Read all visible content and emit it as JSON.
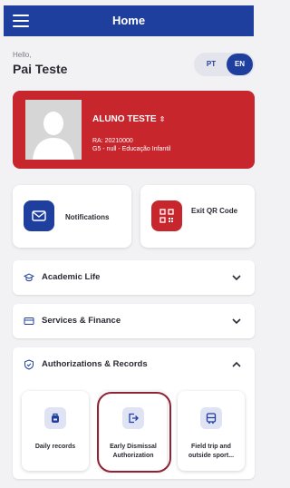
{
  "header": {
    "title": "Home"
  },
  "user": {
    "greeting": "Hello,",
    "name": "Pai Teste"
  },
  "language": {
    "pt": "PT",
    "en": "EN",
    "selected": "EN"
  },
  "student": {
    "name": "ALUNO TESTE",
    "ra": "RA: 20210000",
    "class": "G5 - null - Educação Infantil",
    "card_color": "#c8262d"
  },
  "quick_actions": {
    "notifications": {
      "label": "Notifications",
      "icon": "envelope-icon"
    },
    "exit_qr": {
      "label": "Exit QR Code",
      "icon": "qr-code-icon"
    }
  },
  "sections": [
    {
      "title": "Academic Life",
      "icon": "graduation-cap-icon",
      "expanded": false
    },
    {
      "title": "Services & Finance",
      "icon": "card-icon",
      "expanded": false
    },
    {
      "title": "Authorizations & Records",
      "icon": "shield-check-icon",
      "expanded": true
    }
  ],
  "authorization_items": [
    {
      "label": "Daily records",
      "icon": "backpack-icon"
    },
    {
      "label": "Early Dismissal Authorization",
      "icon": "exit-arrow-icon"
    },
    {
      "label": "Field trip and outside sport...",
      "icon": "bus-icon"
    }
  ],
  "colors": {
    "primary": "#1f3f9e",
    "accent": "#c8262d",
    "highlight": "#8f2335"
  }
}
